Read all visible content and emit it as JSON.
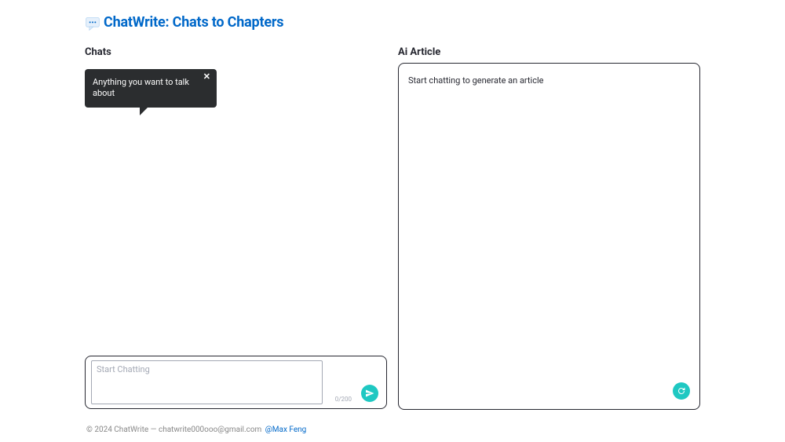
{
  "app": {
    "title": "ChatWrite: Chats to Chapters"
  },
  "chats": {
    "title": "Chats",
    "tooltip": "Anything you want to talk about",
    "input_placeholder": "Start Chatting",
    "char_count": "0/200"
  },
  "article": {
    "title": "Ai Article",
    "placeholder": "Start chatting to generate an article"
  },
  "footer": {
    "copyright": "© 2024 ChatWrite — chatwrite000ooo@gmail.com",
    "author_handle": "@Max Feng"
  }
}
